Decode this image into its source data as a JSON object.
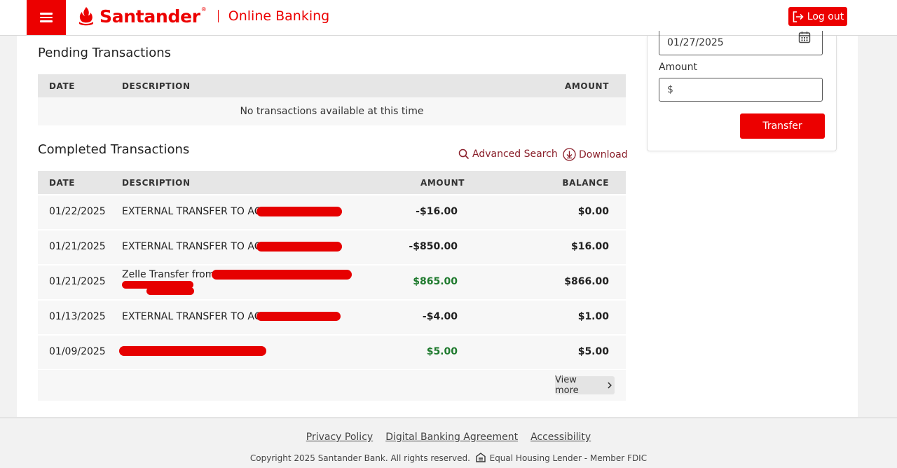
{
  "header": {
    "brand": "Santander",
    "brand_mark": "®",
    "subtitle": "Online Banking",
    "logout_label": "Log out",
    "brand_color": "#ec0000"
  },
  "pending": {
    "title": "Pending Transactions",
    "columns": [
      "DATE",
      "DESCRIPTION",
      "AMOUNT"
    ],
    "empty_message": "No transactions available at this time"
  },
  "completed": {
    "title": "Completed Transactions",
    "advanced_search_label": "Advanced Search",
    "download_label": "Download",
    "columns": [
      "DATE",
      "DESCRIPTION",
      "AMOUNT",
      "BALANCE"
    ],
    "rows": [
      {
        "date": "01/22/2025",
        "description": "EXTERNAL TRANSFER TO ACCT",
        "description_2": "",
        "amount": "-$16.00",
        "balance": "$0.00",
        "credit": false
      },
      {
        "date": "01/21/2025",
        "description": "EXTERNAL TRANSFER TO ACCT",
        "description_2": "",
        "amount": "-$850.00",
        "balance": "$16.00",
        "credit": false
      },
      {
        "date": "01/21/2025",
        "description": "Zelle Transfer from",
        "description_2": "",
        "amount": "$865.00",
        "balance": "$866.00",
        "credit": true
      },
      {
        "date": "01/13/2025",
        "description": "EXTERNAL TRANSFER TO ACCT",
        "description_2": "",
        "amount": "-$4.00",
        "balance": "$1.00",
        "credit": false
      },
      {
        "date": "01/09/2025",
        "description": "",
        "description_2": "",
        "amount": "$5.00",
        "balance": "$5.00",
        "credit": true
      }
    ],
    "view_more_label": "View more"
  },
  "transfer_panel": {
    "date_value": "01/27/2025",
    "amount_label": "Amount",
    "amount_placeholder": "$",
    "transfer_label": "Transfer"
  },
  "footer": {
    "links": [
      "Privacy Policy",
      "Digital Banking Agreement",
      "Accessibility"
    ],
    "copyright": "Copyright 2025 Santander Bank. All rights reserved.",
    "housing": "Equal Housing Lender - Member FDIC"
  },
  "colors": {
    "accent": "#ec0000",
    "credit_green": "#1f7a2e",
    "link_maroon": "#8a1f2a"
  }
}
